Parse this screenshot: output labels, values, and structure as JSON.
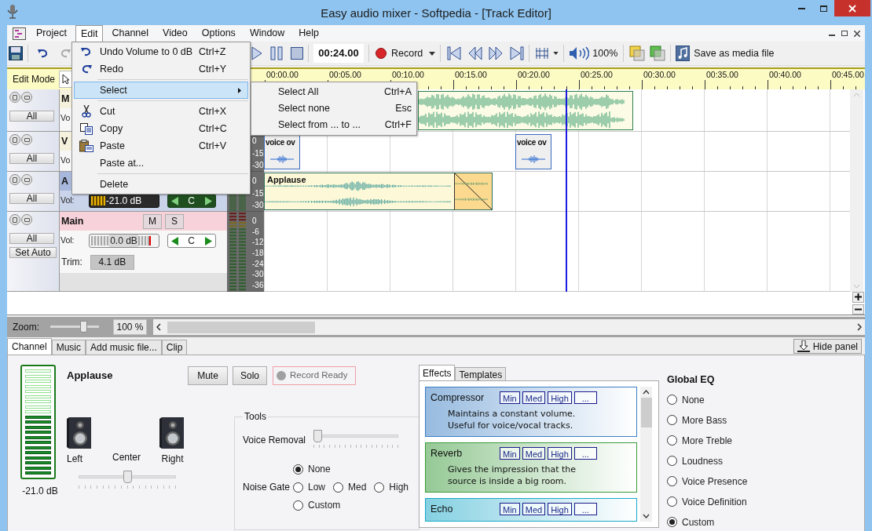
{
  "window": {
    "title": "Easy audio mixer - Softpedia - [Track Editor]"
  },
  "menu_bar": [
    {
      "label": "Project",
      "selected": false
    },
    {
      "label": "Edit",
      "selected": true
    },
    {
      "label": "Channel",
      "selected": false
    },
    {
      "label": "Video",
      "selected": false
    },
    {
      "label": "Options",
      "selected": false
    },
    {
      "label": "Window",
      "selected": false
    },
    {
      "label": "Help",
      "selected": false
    }
  ],
  "edit_menu": [
    {
      "kind": "item",
      "label": "Undo Volume to 0 dB",
      "shortcut": "Ctrl+Z",
      "selected": false
    },
    {
      "kind": "item",
      "label": "Redo",
      "shortcut": "Ctrl+Y",
      "selected": false
    },
    {
      "kind": "separator"
    },
    {
      "kind": "submenu",
      "label": "Select",
      "selected": true
    },
    {
      "kind": "separator"
    },
    {
      "kind": "item",
      "label": "Cut",
      "shortcut": "Ctrl+X",
      "selected": false
    },
    {
      "kind": "item",
      "label": "Copy",
      "shortcut": "Ctrl+C",
      "selected": false
    },
    {
      "kind": "item",
      "label": "Paste",
      "shortcut": "Ctrl+V",
      "selected": false
    },
    {
      "kind": "item",
      "label": "Paste at...",
      "selected": false
    },
    {
      "kind": "separator"
    },
    {
      "kind": "item",
      "label": "Delete",
      "selected": false
    }
  ],
  "select_submenu": [
    {
      "label": "Select All",
      "shortcut": "Ctrl+A"
    },
    {
      "label": "Select none",
      "shortcut": "Esc"
    },
    {
      "label": "Select from ... to ...",
      "shortcut": "Ctrl+F"
    }
  ],
  "toolbar": {
    "time": "00:24.00",
    "record": "Record",
    "volume": "100%",
    "save_media": "Save as media file"
  },
  "ruler": {
    "mode": "Edit Mode",
    "ticks": [
      "00:00.00",
      "00:05.00",
      "00:10.00",
      "00:15.00",
      "00:20.00",
      "00:25.00",
      "00:30.00",
      "00:35.00",
      "00:40.00",
      "00:45.00"
    ]
  },
  "tracks": [
    {
      "kind": "channel",
      "selected": false,
      "name": "M",
      "all": "All",
      "vol_label": "Vo",
      "clips": [
        {
          "kind": "music"
        }
      ]
    },
    {
      "kind": "channel",
      "selected": false,
      "name": "V",
      "all": "All",
      "vol_label": "Vo",
      "meter_scale": [
        "0",
        "-15",
        "-30"
      ],
      "clips": [
        {
          "kind": "voice",
          "label": "voice ov"
        },
        {
          "kind": "voice",
          "label": "voice ov"
        }
      ]
    },
    {
      "kind": "channel",
      "selected": true,
      "name": "A",
      "all": "All",
      "vol_label": "Vol:",
      "volume": {
        "reading": "-21.0 dB",
        "level": 0.35
      },
      "pan": "C",
      "meter_scale": [
        "0",
        "-15",
        "-30"
      ],
      "clips": [
        {
          "kind": "sound",
          "label": "Applause",
          "fade_out": true
        }
      ]
    },
    {
      "kind": "master",
      "selected": false,
      "name": "Main",
      "mute": "M",
      "solo": "S",
      "all": "All",
      "auto": "Set Auto",
      "vol_label": "Vol:",
      "volume": {
        "reading": "0.0 dB",
        "level": 0.95
      },
      "pan": "C",
      "trim_label": "Trim:",
      "trim": "4.1 dB",
      "meter_scale": [
        "0",
        "-6",
        "-12",
        "-18",
        "-24",
        "-30",
        "-36"
      ]
    }
  ],
  "zoom": {
    "label": "Zoom:",
    "level": 0.72,
    "value": "100 %"
  },
  "bottom_tabs": [
    {
      "label": "Channel",
      "selected": true
    },
    {
      "label": "Music",
      "selected": false
    },
    {
      "label": "Add music file...",
      "selected": false
    },
    {
      "label": "Clip",
      "selected": false
    }
  ],
  "hide_panel": "Hide panel",
  "channel_panel": {
    "name": "Applause",
    "meter": {
      "level": 0.57,
      "reading": "-21.0 dB"
    },
    "mute": "Mute",
    "solo": "Solo",
    "record_ready": {
      "label": "Record Ready",
      "on": false
    },
    "speakers": {
      "left": "Left",
      "center": "Center",
      "right": "Right",
      "level": 0.5
    },
    "tools": {
      "title": "Tools",
      "voice_removal": {
        "label": "Voice Removal",
        "level": 0
      },
      "noise_gate": {
        "label": "Noise Gate",
        "options": [
          {
            "label": "None",
            "selected": true
          },
          {
            "label": "Low",
            "selected": false
          },
          {
            "label": "Med",
            "selected": false
          },
          {
            "label": "High",
            "selected": false
          },
          {
            "label": "Custom",
            "selected": false
          }
        ]
      }
    }
  },
  "effects": {
    "tabs": [
      {
        "label": "Effects",
        "selected": true
      },
      {
        "label": "Templates",
        "selected": false
      }
    ],
    "items": [
      {
        "name": "Compressor",
        "color": "#3c7fc4",
        "description": "Maintains a constant volume.\nUseful for voice/vocal tracks.",
        "buttons": [
          "Min",
          "Med",
          "High",
          "..."
        ]
      },
      {
        "name": "Reverb",
        "color": "#3a9a3a",
        "description": "Gives the impression that the\nsource is inside a big room.",
        "buttons": [
          "Min",
          "Med",
          "High",
          "..."
        ]
      },
      {
        "name": "Echo",
        "color": "#1aa8c8",
        "buttons": [
          "Min",
          "Med",
          "High",
          "..."
        ]
      }
    ]
  },
  "global_eq": {
    "title": "Global EQ",
    "options": [
      {
        "label": "None",
        "selected": false
      },
      {
        "label": "More Bass",
        "selected": false
      },
      {
        "label": "More Treble",
        "selected": false
      },
      {
        "label": "Loudness",
        "selected": false
      },
      {
        "label": "Voice Presence",
        "selected": false
      },
      {
        "label": "Voice Definition",
        "selected": false
      },
      {
        "label": "Custom",
        "selected": true
      }
    ]
  }
}
